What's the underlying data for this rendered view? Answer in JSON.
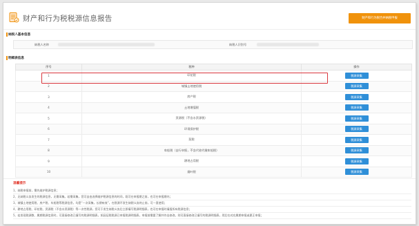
{
  "header": {
    "title": "财产和行为税税源信息报告",
    "action_button": "财产和行为税合并纳税申报"
  },
  "basic_info": {
    "section_title": "纳税人基本信息",
    "taxpayer_name_label": "纳税人名称",
    "taxpayer_id_label": "纳税人识别号"
  },
  "details": {
    "section_title": "明细表信息",
    "columns": [
      "序号",
      "税种",
      "操作"
    ],
    "rows": [
      {
        "no": "1",
        "tax": "印花税",
        "action": "税源采集"
      },
      {
        "no": "2",
        "tax": "城镇土地使用税",
        "action": "税源采集"
      },
      {
        "no": "3",
        "tax": "房产税",
        "action": "税源采集"
      },
      {
        "no": "4",
        "tax": "土地增值税",
        "action": "税源采集"
      },
      {
        "no": "5",
        "tax": "资源税（不含水资源税）",
        "action": "税源采集"
      },
      {
        "no": "6",
        "tax": "环境保护税",
        "action": "税源采集"
      },
      {
        "no": "7",
        "tax": "契税",
        "action": "税源采集"
      },
      {
        "no": "8",
        "tax": "车船税（自行申报，不含代收代缴车船税）",
        "action": "税源采集"
      },
      {
        "no": "9",
        "tax": "耕地占用税",
        "action": "税源采集"
      },
      {
        "no": "10",
        "tax": "烟叶税",
        "action": "税源采集"
      }
    ]
  },
  "tips": {
    "title": "温馨提示",
    "items": [
      "1、纳税申报前，需先维护税源信息；",
      "2、无纳税义务发生的税源信息，无需采集。若需采集，您可自由选择维护税源信息的时间，既可在申报期之前，也可在申报期内；",
      "3、城镇土地使用税、房产税、车船税等税源信息，均是“一次采集，长期有效”，在税源不发生纳税义务终止前，可一直使用；",
      "4、耕地占用税、印花税、资源税（不含水资源税）等一次性税源，您可于发生纳税义务后立即填写税源明细表，也可在申报时填报所有税源信息；",
      "5、若发现税源数、属期税源信息时，可直接修改已填写的税源明细表，如因征税税源已申报税源明细表，申报前需要了解并作出修改，则可直接修改已填写的税源明细表，然后在对应属期申报或更正申报；"
    ]
  },
  "colors": {
    "accent_orange": "#f0920b",
    "button_blue": "#2f8fd8",
    "highlight_red": "#d9353b"
  }
}
